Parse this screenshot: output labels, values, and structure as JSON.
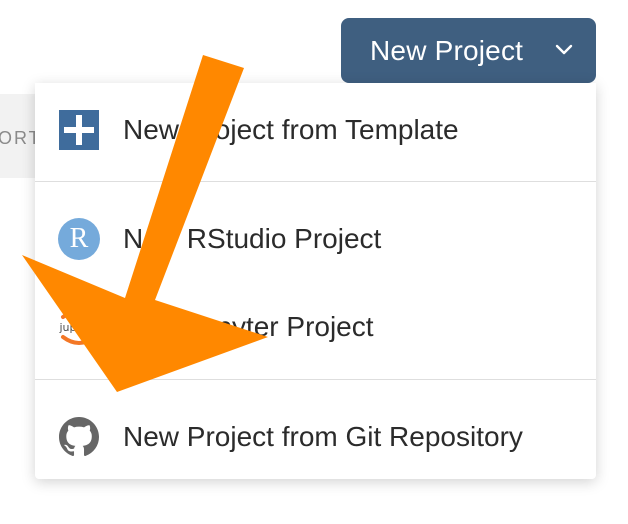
{
  "header": {
    "new_project_label": "New Project"
  },
  "background": {
    "partial_label": "ORT"
  },
  "menu": {
    "items": [
      {
        "label": "New Project from Template",
        "icon": "template-plus-icon"
      },
      {
        "label": "New RStudio Project",
        "icon": "r-logo-icon",
        "icon_text": "R"
      },
      {
        "label": "New Jupyter Project",
        "icon": "jupyter-logo-icon",
        "icon_text": "jupyter"
      },
      {
        "label": "New Project from Git Repository",
        "icon": "github-icon"
      }
    ]
  },
  "colors": {
    "button_bg": "#3f5f80",
    "template_icon": "#3f6c9c",
    "r_icon": "#75aadb",
    "jupyter_orange": "#f37726",
    "annotation_arrow": "#ff8800"
  }
}
